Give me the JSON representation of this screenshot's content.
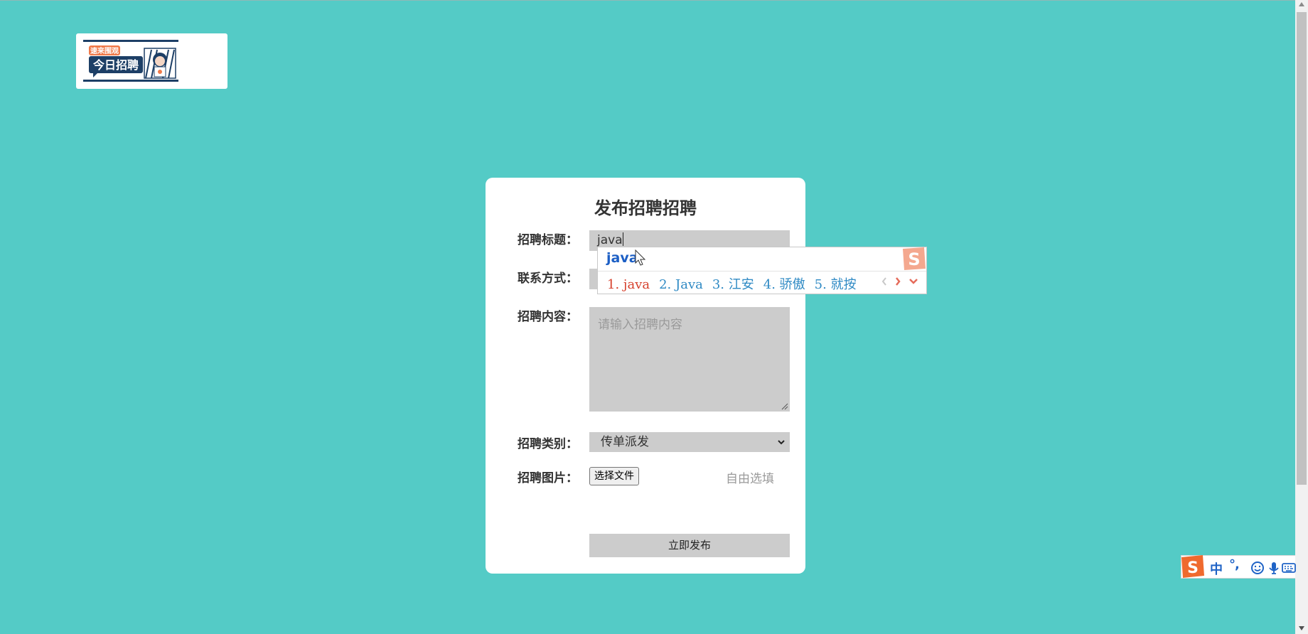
{
  "brand": {
    "logo_badge": "速来围观",
    "logo_text": "今日招聘"
  },
  "form": {
    "title": "发布招聘招聘",
    "labels": {
      "title": "招聘标题：",
      "contact": "联系方式：",
      "content": "招聘内容：",
      "category": "招聘类别：",
      "image": "招聘图片："
    },
    "title_value": "java",
    "content_placeholder": "请输入招聘内容",
    "category_value": "传单派发",
    "file_button": "选择文件",
    "file_hint": "自由选填",
    "submit": "立即发布"
  },
  "ime": {
    "composition": "java",
    "candidates": [
      "1. java",
      "2. Java",
      "3. 江安",
      "4. 骄傲",
      "5. 就按"
    ]
  },
  "ime_toolbar": {
    "mode": "中",
    "punctuation": "°,"
  },
  "colors": {
    "page_bg": "#54cbc6",
    "field_bg": "#cccccc",
    "ime_brand": "#f07a4a",
    "ime_blue": "#1f63c6",
    "ime_first_candidate": "#d6402c"
  },
  "icons": {
    "ime_logo": "sogou-s-icon",
    "toolbar": [
      "emoji-icon",
      "microphone-icon",
      "keyboard-icon"
    ]
  }
}
